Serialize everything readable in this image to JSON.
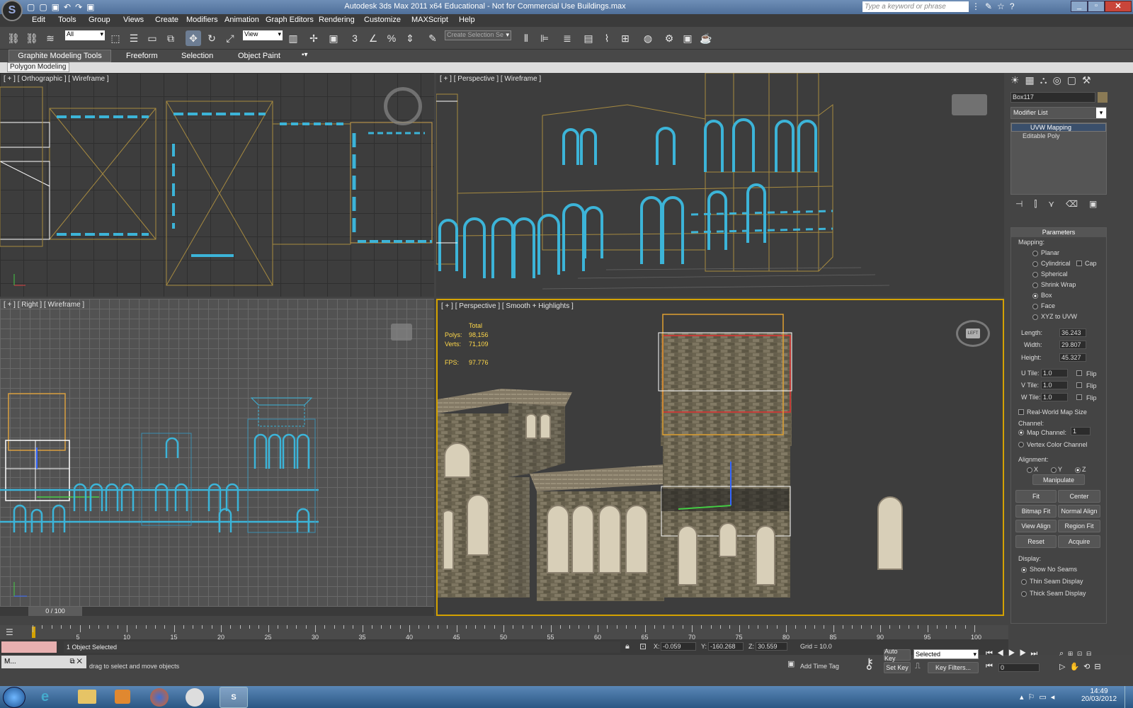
{
  "title": "Autodesk 3ds Max  2011 x64    Educational - Not for Commercial Use    Buildings.max",
  "search_placeholder": "Type a keyword or phrase",
  "menus": [
    "Edit",
    "Tools",
    "Group",
    "Views",
    "Create",
    "Modifiers",
    "Animation",
    "Graph Editors",
    "Rendering",
    "Customize",
    "MAXScript",
    "Help"
  ],
  "toolbar": {
    "selection_filter": "All",
    "ref_coord": "View",
    "named_sel": "Create Selection Se"
  },
  "ribbon_tabs": [
    "Graphite Modeling Tools",
    "Freeform",
    "Selection",
    "Object Paint"
  ],
  "ribbon_sub": "Polygon Modeling",
  "viewports": {
    "top_left": "[ + ] [ Orthographic ] [ Wireframe ]",
    "top_right": "[ + ] [ Perspective ] [ Wireframe ]",
    "bottom_left": "[ + ] [ Right ] [ Wireframe ]",
    "bottom_right": "[ + ] [ Perspective ] [ Smooth + Highlights ]"
  },
  "stats": {
    "total": "Total",
    "polys_label": "Polys:",
    "polys": "98,156",
    "verts_label": "Verts:",
    "verts": "71,109",
    "fps_label": "FPS:",
    "fps": "97.776"
  },
  "viewcube_left": "LEFT",
  "command_panel": {
    "object_name": "Box117",
    "modifier_list": "Modifier List",
    "stack": [
      "UVW Mapping",
      "Editable Poly"
    ],
    "params_title": "Parameters",
    "mapping_label": "Mapping:",
    "mapping_options": [
      "Planar",
      "Cylindrical",
      "Spherical",
      "Shrink Wrap",
      "Box",
      "Face",
      "XYZ to UVW"
    ],
    "selected_mapping": "Box",
    "cap": "Cap",
    "length_label": "Length:",
    "length": "36.243",
    "width_label": "Width:",
    "width": "29.807",
    "height_label": "Height:",
    "height": "45.327",
    "utile_label": "U Tile:",
    "utile": "1.0",
    "vtile_label": "V Tile:",
    "vtile": "1.0",
    "wtile_label": "W Tile:",
    "wtile": "1.0",
    "flip": "Flip",
    "realworld": "Real-World Map Size",
    "channel_label": "Channel:",
    "map_channel_label": "Map Channel:",
    "map_channel": "1",
    "vertex_color": "Vertex Color Channel",
    "alignment_label": "Alignment:",
    "axes": [
      "X",
      "Y",
      "Z"
    ],
    "manipulate": "Manipulate",
    "buttons": [
      "Fit",
      "Center",
      "Bitmap Fit",
      "Normal Align",
      "View Align",
      "Region Fit",
      "Reset",
      "Acquire"
    ],
    "display_label": "Display:",
    "display_options": [
      "Show No Seams",
      "Thin Seam Display",
      "Thick Seam Display"
    ]
  },
  "time_slider": "0 / 100",
  "ticks": [
    "5",
    "10",
    "15",
    "20",
    "25",
    "30",
    "35",
    "40",
    "45",
    "50",
    "55",
    "60",
    "65",
    "70",
    "75",
    "80",
    "85",
    "90",
    "95",
    "100"
  ],
  "status": {
    "selected": "1 Object Selected",
    "prompt": "drag to select and move objects",
    "x": "-0.059",
    "y": "-160.268",
    "z": "30.559",
    "grid": "Grid = 10.0",
    "add_time_tag": "Add Time Tag",
    "auto_key": "Auto Key",
    "set_key": "Set Key",
    "selected_dd": "Selected",
    "key_filters": "Key Filters...",
    "frame": "0",
    "taskbar_app": "M..."
  },
  "clock": {
    "time": "14:49",
    "date": "20/03/2012"
  }
}
